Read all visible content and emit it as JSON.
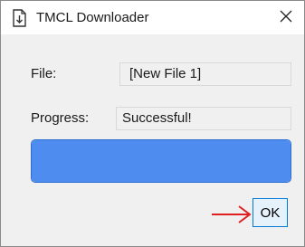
{
  "window": {
    "title": "TMCL Downloader",
    "app_icon": "document-download-icon",
    "close_icon": "close-icon"
  },
  "form": {
    "file_label": "File:",
    "file_value": "[New File 1]",
    "progress_label": "Progress:",
    "progress_value": "Successful!"
  },
  "progress_bar": {
    "fraction": 1.0,
    "color": "#4f8cf0",
    "border_color": "#2d6fd0"
  },
  "buttons": {
    "ok_label": "OK"
  },
  "annotation": {
    "arrow_icon": "red-arrow-icon",
    "arrow_color": "#e02020"
  }
}
